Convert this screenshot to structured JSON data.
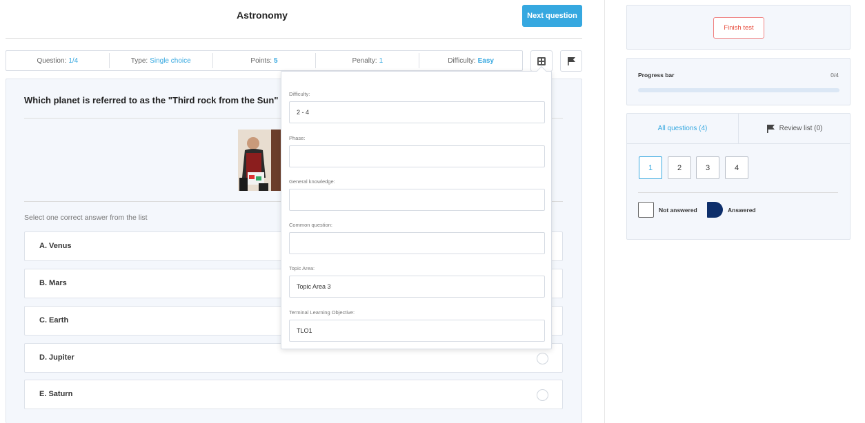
{
  "header": {
    "title": "Astronomy",
    "next_button": "Next question"
  },
  "info_bar": [
    {
      "label": "Question:",
      "value": "1/4",
      "bold": false
    },
    {
      "label": "Type:",
      "value": "Single choice",
      "bold": false
    },
    {
      "label": "Points:",
      "value": "5",
      "bold": true
    },
    {
      "label": "Penalty:",
      "value": "1",
      "bold": false
    },
    {
      "label": "Difficulty:",
      "value": "Easy",
      "bold": true
    }
  ],
  "question": {
    "text": "Which planet is referred to as the \"Third rock from the Sun\" by",
    "instruction": "Select one correct answer from the list",
    "answers": [
      {
        "label": "A.  Venus"
      },
      {
        "label": "B.  Mars"
      },
      {
        "label": "C.  Earth"
      },
      {
        "label": "D.  Jupiter"
      },
      {
        "label": "E.  Saturn"
      }
    ]
  },
  "popup": {
    "fields": [
      {
        "label": "Difficulty:",
        "value": "2 - 4"
      },
      {
        "label": "Phase:",
        "value": ""
      },
      {
        "label": "General knowledge:",
        "value": ""
      },
      {
        "label": "Common question:",
        "value": ""
      },
      {
        "label": "Topic Area:",
        "value": "Topic Area 3"
      },
      {
        "label": "Terminal Learning Objective:",
        "value": "TLO1"
      }
    ]
  },
  "sidebar": {
    "finish_button": "Finish test",
    "progress": {
      "label": "Progress bar",
      "count": "0/4",
      "fraction": 0
    },
    "tabs": {
      "all": "All questions (4)",
      "review": "Review list (0)"
    },
    "question_numbers": [
      "1",
      "2",
      "3",
      "4"
    ],
    "legend": {
      "not_answered": "Not answered",
      "answered": "Answered"
    }
  },
  "colors": {
    "accent": "#36a8e0",
    "danger": "#e74c3c",
    "answered": "#0e2f6b"
  }
}
